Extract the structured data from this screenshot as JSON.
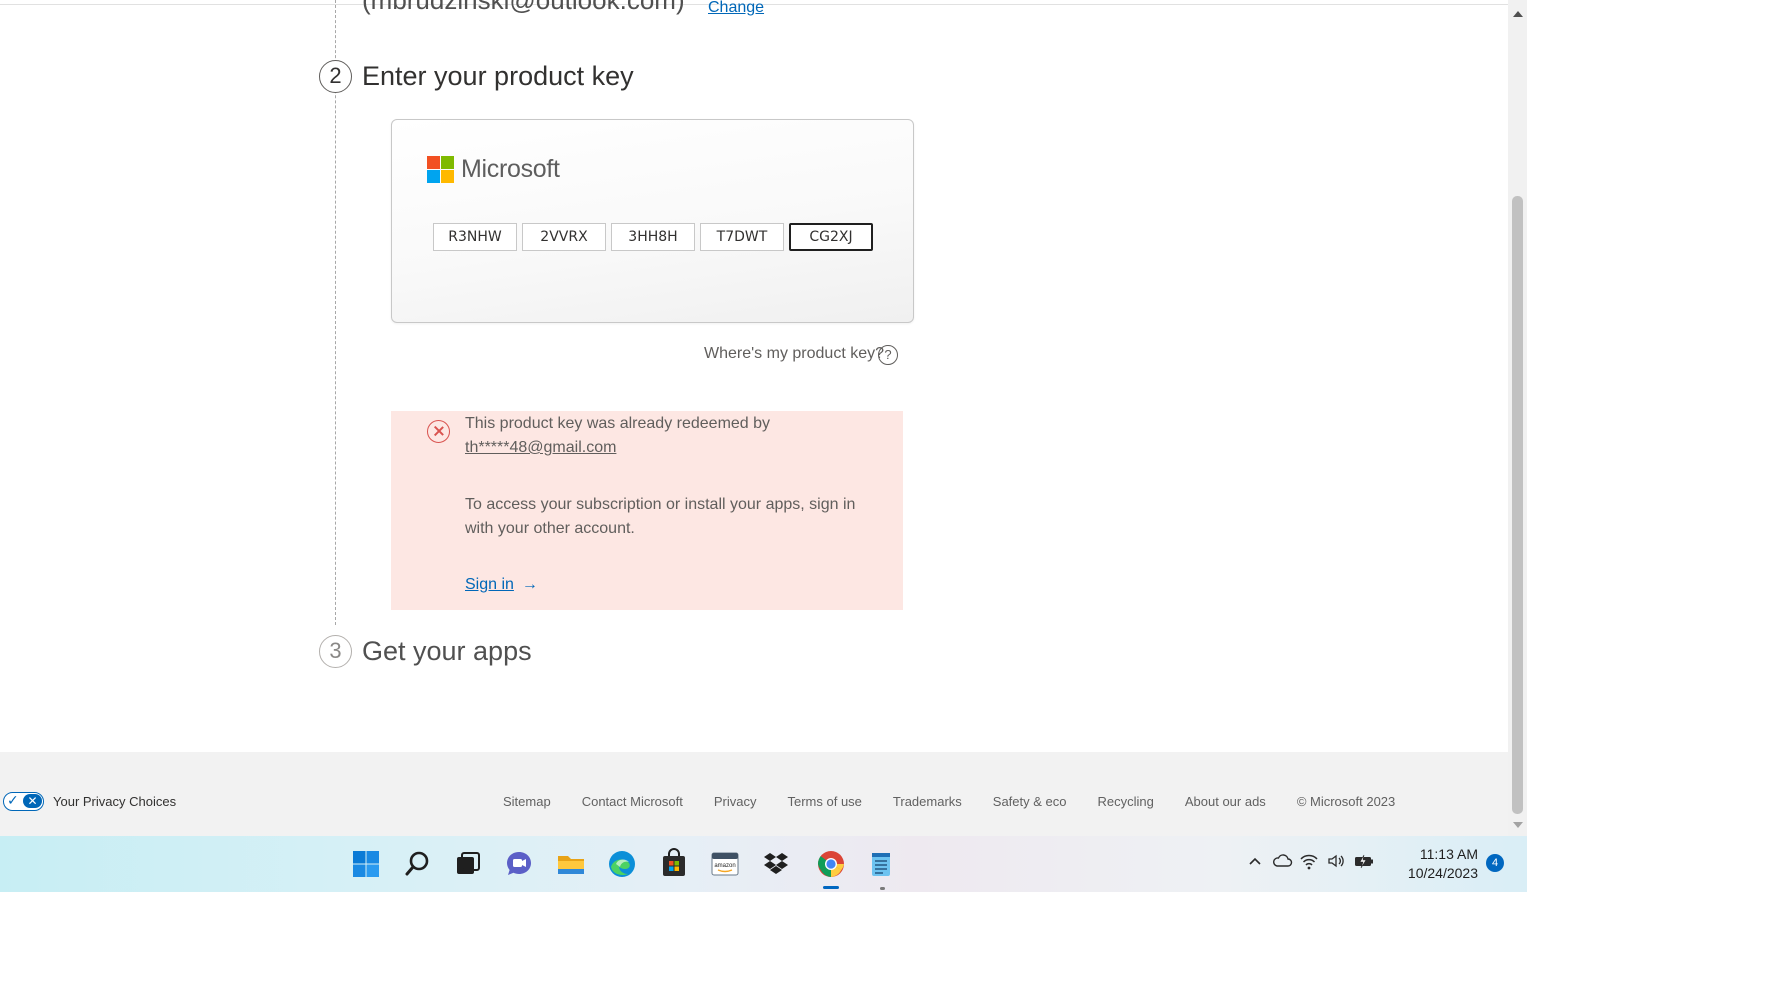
{
  "account": {
    "email": "(mbrudzinski@outlook.com)",
    "change_label": "Change"
  },
  "steps": [
    {
      "number": "2",
      "title": "Enter your product key"
    },
    {
      "number": "3",
      "title": "Get your apps"
    }
  ],
  "key_card": {
    "brand": "Microsoft",
    "segments": [
      "R3NHW",
      "2VVRX",
      "3HH8H",
      "T7DWT",
      "CG2XJ"
    ],
    "help_text": "Where's my product key?",
    "help_icon": "question-circle-icon"
  },
  "error": {
    "icon": "error-x-circle-icon",
    "line1": "This product key was already redeemed by",
    "redeemed_email": "th*****48@gmail.com",
    "line2a": "To access your subscription or install your apps, sign in",
    "line2b": "with your other account.",
    "signin_label": "Sign in",
    "signin_arrow": "→",
    "color": "#fde7e3"
  },
  "footer": {
    "privacy_label": "Your Privacy Choices",
    "links": [
      "Sitemap",
      "Contact Microsoft",
      "Privacy",
      "Terms of use",
      "Trademarks",
      "Safety & eco",
      "Recycling",
      "About our ads",
      "© Microsoft 2023"
    ]
  },
  "taskbar": {
    "apps": [
      "windows-start-icon",
      "search-icon",
      "task-view-icon",
      "chat-icon",
      "file-explorer-icon",
      "edge-icon",
      "store-icon",
      "amazon-icon",
      "dropbox-icon",
      "chrome-icon",
      "notepad-icon"
    ],
    "active_app": "chrome-icon",
    "time": "11:13 AM",
    "date": "10/24/2023",
    "notification_count": "4"
  },
  "colors": {
    "link": "#0067b8",
    "ms_red": "#f25022",
    "ms_green": "#7fba00",
    "ms_blue": "#00a4ef",
    "ms_yellow": "#ffb900"
  }
}
